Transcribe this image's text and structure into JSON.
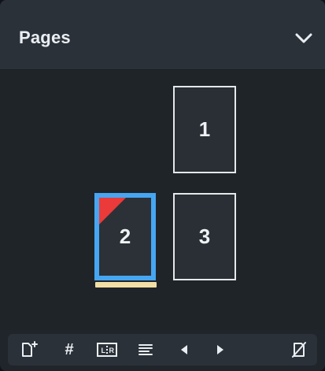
{
  "panel": {
    "title": "Pages",
    "collapse_icon": "chevron-down-icon"
  },
  "pages": [
    {
      "number": "1",
      "selected": false
    },
    {
      "number": "2",
      "selected": true,
      "has_red_corner": true,
      "has_highlight_bar": true
    },
    {
      "number": "3",
      "selected": false
    }
  ],
  "toolbar": {
    "buttons": [
      {
        "name": "add-page",
        "icon": "page-plus-icon"
      },
      {
        "name": "page-number",
        "label": "#"
      },
      {
        "name": "left-right-pages",
        "icon": "left-right-pages-icon"
      },
      {
        "name": "text-align",
        "icon": "align-left-icon"
      },
      {
        "name": "previous",
        "icon": "triangle-left-icon"
      },
      {
        "name": "next",
        "icon": "triangle-right-icon"
      },
      {
        "name": "clear",
        "icon": "page-slash-icon"
      }
    ],
    "left_right_label": "L|R"
  },
  "colors": {
    "panel_bg": "#20252b",
    "header_bg": "#2b3138",
    "selection_blue": "#46a6f2",
    "corner_red": "#ea3a3a",
    "highlight_yellow": "#f3dfa5"
  }
}
